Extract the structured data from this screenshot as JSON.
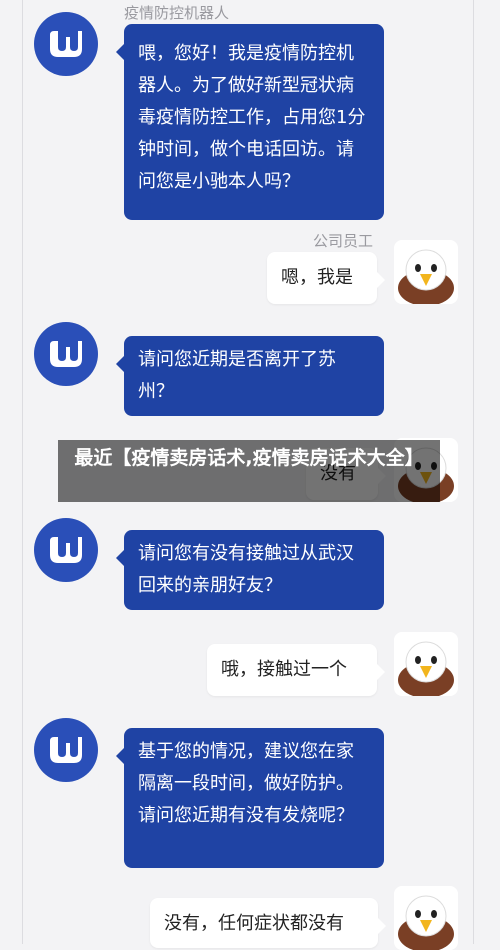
{
  "header": {
    "bot_name": "疫情防控机器人",
    "user_name": "公司员工"
  },
  "messages": [
    {
      "from": "bot",
      "text": "喂，您好！我是疫情防控机器人。为了做好新型冠状病毒疫情防控工作，占用您1分钟时间，做个电话回访。请问您是小驰本人吗？"
    },
    {
      "from": "user",
      "text": "嗯，我是"
    },
    {
      "from": "bot",
      "text": "请问您近期是否离开了苏州？"
    },
    {
      "from": "user",
      "text": "没有"
    },
    {
      "from": "bot",
      "text": "请问您有没有接触过从武汉回来的亲朋好友？"
    },
    {
      "from": "user",
      "text": "哦，接触过一个"
    },
    {
      "from": "bot",
      "text": "基于您的情况，建议您在家隔离一段时间，做好防护。请问您近期有没有发烧呢？"
    },
    {
      "from": "user",
      "text": "没有，任何症状都没有"
    }
  ],
  "overlay_title": "最近【疫情卖房话术,疫情卖房话术大全】",
  "icons": {
    "bot": "robot-logo-icon",
    "user": "eagle-avatar-icon"
  }
}
